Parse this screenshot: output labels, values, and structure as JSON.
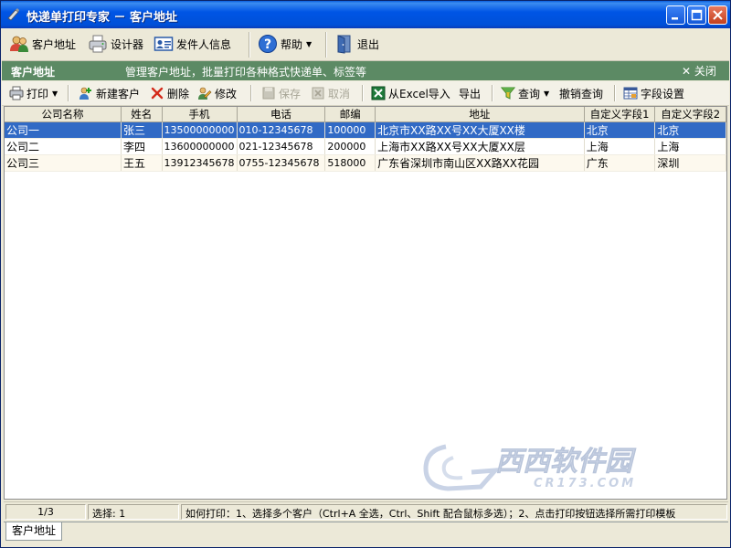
{
  "window": {
    "title": "快递单打印专家 － 客户地址"
  },
  "main_toolbar": {
    "customer_address": "客户地址",
    "designer": "设计器",
    "sender_info": "发件人信息",
    "help": "帮助",
    "exit": "退出"
  },
  "panel": {
    "title": "客户地址",
    "description": "管理客户地址，批量打印各种格式快递单、标签等",
    "close": "关闭"
  },
  "sub_toolbar": {
    "print": "打印",
    "new_customer": "新建客户",
    "delete": "删除",
    "modify": "修改",
    "save": "保存",
    "cancel": "取消",
    "import_excel": "从Excel导入",
    "export": "导出",
    "query": "查询",
    "cancel_query": "撤销查询",
    "field_settings": "字段设置"
  },
  "grid": {
    "columns": [
      "公司名称",
      "姓名",
      "手机",
      "电话",
      "邮编",
      "地址",
      "自定义字段1",
      "自定义字段2"
    ],
    "rows": [
      [
        "公司一",
        "张三",
        "13500000000",
        "010-12345678",
        "100000",
        "北京市XX路XX号XX大厦XX楼",
        "北京",
        "北京"
      ],
      [
        "公司二",
        "李四",
        "13600000000",
        "021-12345678",
        "200000",
        "上海市XX路XX号XX大厦XX层",
        "上海",
        "上海"
      ],
      [
        "公司三",
        "王五",
        "13912345678",
        "0755-12345678",
        "518000",
        "广东省深圳市南山区XX路XX花园",
        "广东",
        "深圳"
      ]
    ],
    "selected_row": 0
  },
  "watermark": {
    "text": "西西软件园",
    "sub": "CR173.COM"
  },
  "status_bar": {
    "page": "1/3",
    "selection": "选择: 1",
    "hint": "如何打印：1、选择多个客户（Ctrl+A 全选，Ctrl、Shift 配合鼠标多选）；2、点击打印按钮选择所需打印模板"
  },
  "bottom_tab": {
    "label": "客户地址"
  },
  "colors": {
    "titlebar": "#0055E5",
    "panel_header": "#5C8A64",
    "selection": "#316AC5",
    "window_bg": "#ECE9D8"
  }
}
